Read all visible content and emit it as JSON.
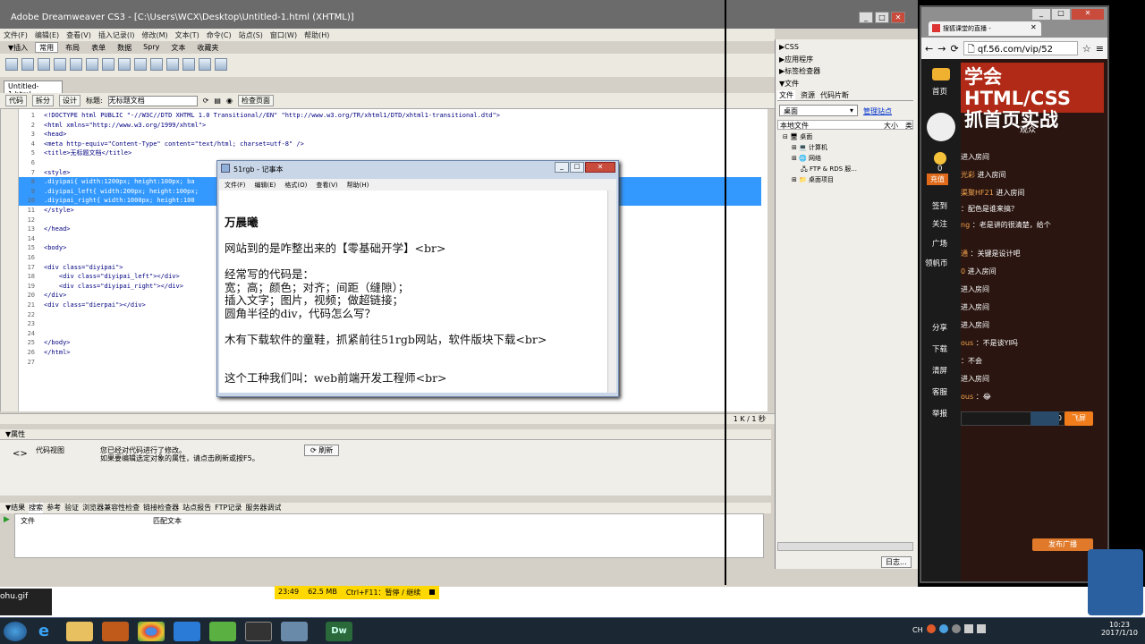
{
  "dreamweaver": {
    "title": "Adobe Dreamweaver CS3 - [C:\\Users\\WCX\\Desktop\\Untitled-1.html (XHTML)]",
    "menu": [
      "文件(F)",
      "编辑(E)",
      "查看(V)",
      "插入记录(I)",
      "修改(M)",
      "文本(T)",
      "命令(C)",
      "站点(S)",
      "窗口(W)",
      "帮助(H)"
    ],
    "insert_label": "▼插入",
    "insert_tabs": [
      "常用",
      "布局",
      "表单",
      "数据",
      "Spry",
      "文本",
      "收藏夹"
    ],
    "doc_tab": "Untitled-1.html",
    "view_buttons": [
      "代码",
      "拆分",
      "设计"
    ],
    "title_label": "标题:",
    "title_value": "无标题文档",
    "check_page": "检查页面",
    "code_lines": [
      {
        "n": "1",
        "t": "<!DOCTYPE html PUBLIC \"-//W3C//DTD XHTML 1.0 Transitional//EN\" \"http://www.w3.org/TR/xhtml1/DTD/xhtml1-transitional.dtd\">"
      },
      {
        "n": "2",
        "t": "<html xmlns=\"http://www.w3.org/1999/xhtml\">"
      },
      {
        "n": "3",
        "t": "<head>"
      },
      {
        "n": "4",
        "t": "<meta http-equiv=\"Content-Type\" content=\"text/html; charset=utf-8\" />"
      },
      {
        "n": "5",
        "t": "<title>无标题文档</title>"
      },
      {
        "n": "6",
        "t": ""
      },
      {
        "n": "7",
        "t": "<style>"
      },
      {
        "n": "8",
        "t": ".diyipai{ width:1200px; height:100px; ba"
      },
      {
        "n": "9",
        "t": ".diyipai_left{ width:200px; height:100px;"
      },
      {
        "n": "10",
        "t": ".diyipai_right{ width:1000px; height:100"
      },
      {
        "n": "11",
        "t": "</style>"
      },
      {
        "n": "12",
        "t": ""
      },
      {
        "n": "13",
        "t": "</head>"
      },
      {
        "n": "14",
        "t": ""
      },
      {
        "n": "15",
        "t": "<body>"
      },
      {
        "n": "16",
        "t": ""
      },
      {
        "n": "17",
        "t": "<div class=\"diyipai\">"
      },
      {
        "n": "18",
        "t": "    <div class=\"diyipai_left\"></div>"
      },
      {
        "n": "19",
        "t": "    <div class=\"diyipai_right\"></div>"
      },
      {
        "n": "20",
        "t": "</div>"
      },
      {
        "n": "21",
        "t": "<div class=\"dierpai\"></div>"
      },
      {
        "n": "22",
        "t": ""
      },
      {
        "n": "23",
        "t": ""
      },
      {
        "n": "24",
        "t": ""
      },
      {
        "n": "25",
        "t": "</body>"
      },
      {
        "n": "26",
        "t": "</html>"
      },
      {
        "n": "27",
        "t": ""
      }
    ],
    "status_right": "1 K / 1 秒",
    "properties_label": "▼属性",
    "code_view_label": "代码视图",
    "props_msg1": "您已经对代码进行了修改。",
    "props_msg2": "如果要编辑选定对象的属性，请点击刷新或按F5。",
    "refresh_label": "刷新",
    "results_tabs": [
      "▼结果",
      "搜索",
      "参考",
      "验证",
      "浏览器兼容性检查",
      "链接检查器",
      "站点报告",
      "FTP记录",
      "服务器调试"
    ],
    "results_cols": [
      "文件",
      "匹配文本"
    ],
    "right_panels": [
      "▶CSS",
      "▶应用程序",
      "▶标签检查器",
      "▼文件"
    ],
    "files_tabs": [
      "文件",
      "资源",
      "代码片断"
    ],
    "site_select": "桌面",
    "manage_site": "管理站点",
    "local_files": "本地文件",
    "size_col": "大小",
    "type_col": "类",
    "tree": [
      "桌面",
      "计算机",
      "网络",
      "FTP & RDS 服...",
      "桌面项目"
    ],
    "log_btn": "日志..."
  },
  "notepad": {
    "title": "51rgb - 记事本",
    "menu": [
      "文件(F)",
      "编辑(E)",
      "格式(O)",
      "查看(V)",
      "帮助(H)"
    ],
    "lines": [
      "万晨曦",
      "",
      "网站到的是咋整出来的【零基础开学】<br>",
      "",
      "经常写的代码是：",
      "宽；高；颜色；对齐；间距（缝隙）；",
      "插入文字；图片，视频；做超链接；",
      "圆角半径的div，代码怎么写？",
      "",
      "木有下载软件的童鞋，抓紧前往51rgb网站，软件版块下载<br>",
      "",
      "",
      "这个工种我们叫：web前端开发工程师<br>"
    ]
  },
  "browser": {
    "tab_title": "搜狐课堂的直播 -",
    "url": "qf.56.com/vip/52",
    "banner": [
      "学会HTML/CSS",
      "抓首页实战"
    ],
    "side": [
      "首页",
      "观众",
      "签到",
      "关注",
      "广场",
      "领帆币",
      "分享",
      "下载",
      "清屏",
      "客服",
      "举报"
    ],
    "badge_num": "0",
    "recharge": "充值",
    "chats": [
      {
        "u": "",
        "m": "进入房间"
      },
      {
        "u": "光彩",
        "m": "进入房间"
      },
      {
        "u": "渠聚HF21",
        "m": "进入房间"
      },
      {
        "u": "",
        "m": "：配色是谁来搞？"
      },
      {
        "u": "ng",
        "m": "：老是讲的很清楚，给个"
      },
      {
        "u": "通",
        "m": "：关键是设计吧"
      },
      {
        "u": "0",
        "m": "进入房间"
      },
      {
        "u": "",
        "m": "进入房间"
      },
      {
        "u": "",
        "m": "进入房间"
      },
      {
        "u": "",
        "m": "进入房间"
      },
      {
        "u": "ous",
        "m": "：不是谈YI吗"
      },
      {
        "u": "",
        "m": "：不会"
      },
      {
        "u": "",
        "m": "进入房间"
      },
      {
        "u": "ous",
        "m": "：😂"
      }
    ],
    "fly_count": "30",
    "fly_btn": "飞屏",
    "broadcast": "发布广播"
  },
  "overlay": {
    "time": "23:49",
    "mem": "62.5 MB",
    "hint": "Ctrl+F11：暂停 / 继续"
  },
  "desktop_file": "ohu.gif",
  "taskbar": {
    "clock_time": "10:23",
    "clock_date": "2017/1/10",
    "tray_lang": "CH"
  }
}
